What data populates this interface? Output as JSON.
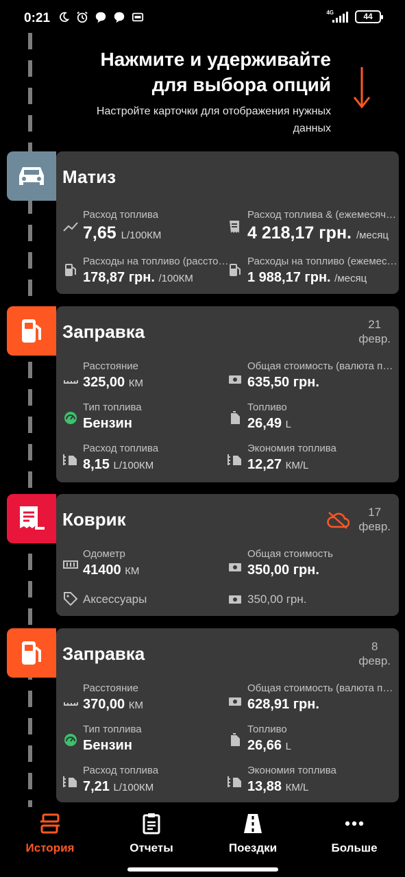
{
  "status_bar": {
    "time": "0:21",
    "network": "4G",
    "battery": "44",
    "icons": [
      "moon-icon",
      "alarm-icon",
      "chat-bubble-icon",
      "chat-bubble-icon",
      "gps-icon"
    ]
  },
  "hint": {
    "title": "Нажмите и удерживайте для выбора опций",
    "subtitle": "Настройте карточки для отображения нужных данных"
  },
  "colors": {
    "accent": "#ff5722",
    "vehicle": "#6e8a9a",
    "expense": "#e8163a",
    "card_bg": "#3a3a3a",
    "green": "#39c36b"
  },
  "vehicle_card": {
    "title": "Матиз",
    "stats": [
      {
        "label": "Расход топлива",
        "value": "7,65",
        "unit": "L/100КМ",
        "icon": "trend-icon"
      },
      {
        "label": "Расход топлива & (ежемесячно)",
        "value": "4 218,17 грн.",
        "unit": "/месяц",
        "icon": "receipt-icon"
      },
      {
        "label": "Расходы на топливо (расстояние)",
        "value": "178,87 грн.",
        "unit": "/100КМ",
        "icon": "fuel-pump-icon"
      },
      {
        "label": "Расходы на топливо (ежемесячно)",
        "value": "1 988,17 грн.",
        "unit": "/месяц",
        "icon": "fuel-pump-icon"
      }
    ]
  },
  "refuel_1": {
    "title": "Заправка",
    "date_day": "21",
    "date_month": "февр.",
    "stats": [
      {
        "label": "Расстояние",
        "value": "325,00",
        "unit": "КМ"
      },
      {
        "label": "Общая стоимость (валюта по умолчанию)",
        "value": "635,50 грн.",
        "unit": ""
      },
      {
        "label": "Тип топлива",
        "value": "Бензин",
        "unit": ""
      },
      {
        "label": "Топливо",
        "value": "26,49",
        "unit": "L"
      },
      {
        "label": "Расход топлива",
        "value": "8,15",
        "unit": "L/100КМ"
      },
      {
        "label": "Экономия топлива",
        "value": "12,27",
        "unit": "КМ/L"
      }
    ]
  },
  "expense_card": {
    "title": "Коврик",
    "date_day": "17",
    "date_month": "февр.",
    "stats": [
      {
        "label": "Одометр",
        "value": "41400",
        "unit": "КМ"
      },
      {
        "label": "Общая стоимость",
        "value": "350,00 грн.",
        "unit": ""
      }
    ],
    "category": "Аксессуары",
    "amount": "350,00 грн."
  },
  "refuel_2": {
    "title": "Заправка",
    "date_day": "8",
    "date_month": "февр.",
    "stats": [
      {
        "label": "Расстояние",
        "value": "370,00",
        "unit": "КМ"
      },
      {
        "label": "Общая стоимость (валюта по умолчанию)",
        "value": "628,91 грн.",
        "unit": ""
      },
      {
        "label": "Тип топлива",
        "value": "Бензин",
        "unit": ""
      },
      {
        "label": "Топливо",
        "value": "26,66",
        "unit": "L"
      },
      {
        "label": "Расход топлива",
        "value": "7,21",
        "unit": "L/100КМ"
      },
      {
        "label": "Экономия топлива",
        "value": "13,88",
        "unit": "КМ/L"
      }
    ]
  },
  "nav": {
    "items": [
      {
        "label": "История",
        "icon": "history-icon",
        "active": true
      },
      {
        "label": "Отчеты",
        "icon": "clipboard-icon",
        "active": false
      },
      {
        "label": "Поездки",
        "icon": "road-icon",
        "active": false
      },
      {
        "label": "Больше",
        "icon": "more-icon",
        "active": false
      }
    ]
  }
}
